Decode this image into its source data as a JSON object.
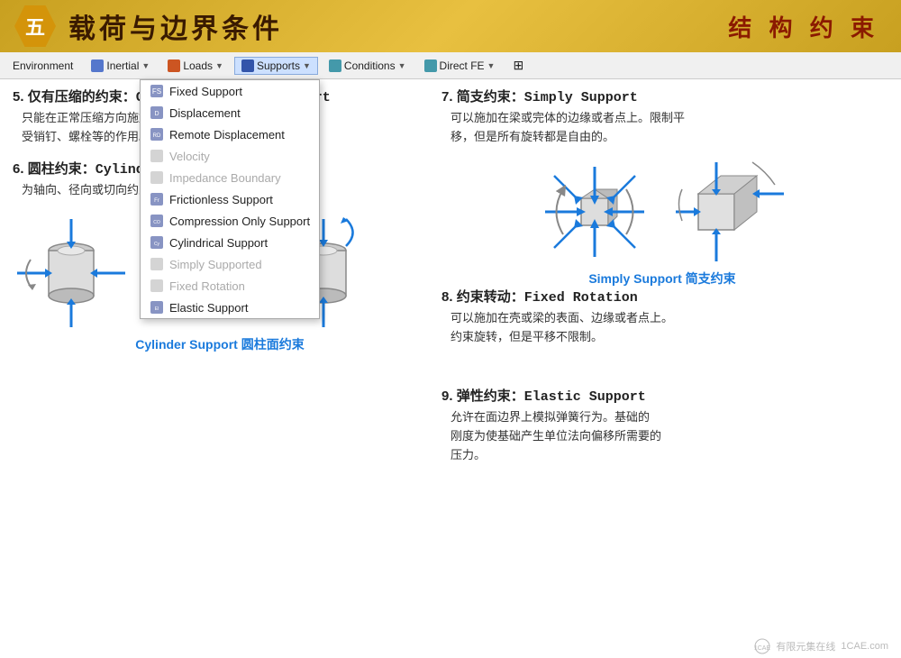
{
  "header": {
    "number": "五",
    "title": "载荷与边界条件",
    "subtitle": "结 构 约 束"
  },
  "toolbar": {
    "items": [
      {
        "label": "Environment",
        "has_arrow": false
      },
      {
        "label": "Inertial",
        "has_arrow": true
      },
      {
        "label": "Loads",
        "has_arrow": true
      },
      {
        "label": "Supports",
        "has_arrow": true,
        "active": true
      },
      {
        "label": "Conditions",
        "has_arrow": true
      },
      {
        "label": "Direct FE",
        "has_arrow": true
      }
    ]
  },
  "dropdown": {
    "items": [
      {
        "label": "Fixed Support",
        "disabled": false,
        "highlighted": false
      },
      {
        "label": "Displacement",
        "disabled": false,
        "highlighted": false
      },
      {
        "label": "Remote Displacement",
        "disabled": false,
        "highlighted": false
      },
      {
        "label": "Velocity",
        "disabled": true,
        "highlighted": false
      },
      {
        "label": "Impedance Boundary",
        "disabled": true,
        "highlighted": false
      },
      {
        "label": "Frictionless Support",
        "disabled": false,
        "highlighted": false
      },
      {
        "label": "Compression Only Support",
        "disabled": false,
        "highlighted": false
      },
      {
        "label": "Cylindrical Support",
        "disabled": false,
        "highlighted": false
      },
      {
        "label": "Simply Supported",
        "disabled": true,
        "highlighted": false
      },
      {
        "label": "Fixed Rotation",
        "disabled": true,
        "highlighted": false
      },
      {
        "label": "Elastic Support",
        "disabled": false,
        "highlighted": false
      }
    ]
  },
  "sections": {
    "s5": {
      "number": "5.",
      "title_zh": "仅有压缩的约束：",
      "title_en": "Compression Only Support",
      "body": "只能在正常压缩方向施加约束。可以模拟圆柱面上\n受销钉、螺栓等的作用。需要进行迭代(非线性)求解。"
    },
    "s6": {
      "number": "6.",
      "title_zh": "圆柱约束：",
      "title_en": "Cylindrical Support",
      "body": "为轴向、径向或切向约束提供单独自施加在圆柱面上。"
    },
    "s7": {
      "number": "7.",
      "title_zh": "简支约束：",
      "title_en": "Simply Support",
      "body": "可以施加在梁或完体的边缘或者点上。限制平\n移，但是所有旋转都是自由的。",
      "diagram_label": "Simply Support 简支约束"
    },
    "s8": {
      "number": "8.",
      "title_zh": "约束转动：",
      "title_en": "Fixed Rotation",
      "body": "可以施加在壳或梁的表面、边缘或者点上。\n约束旋转，但是平移不限制。"
    },
    "s9": {
      "number": "9.",
      "title_zh": "弹性约束：",
      "title_en": "Elastic Support",
      "body": "允许在面边界上模拟弹簧行为。基础的\n刚度为使基础产生单位法向偏移所需要的\n压力。"
    },
    "cylinder_label": "Cylinder Support 圆柱面约束"
  },
  "watermark": {
    "site": "1CAE.com",
    "org": "有限元集在线"
  },
  "colors": {
    "accent_blue": "#1a7adc",
    "header_gold": "#d4940a",
    "header_bg": "#e8c040",
    "menu_highlight": "#dce8ff",
    "text_dark": "#222222",
    "text_gray": "#aaaaaa"
  }
}
